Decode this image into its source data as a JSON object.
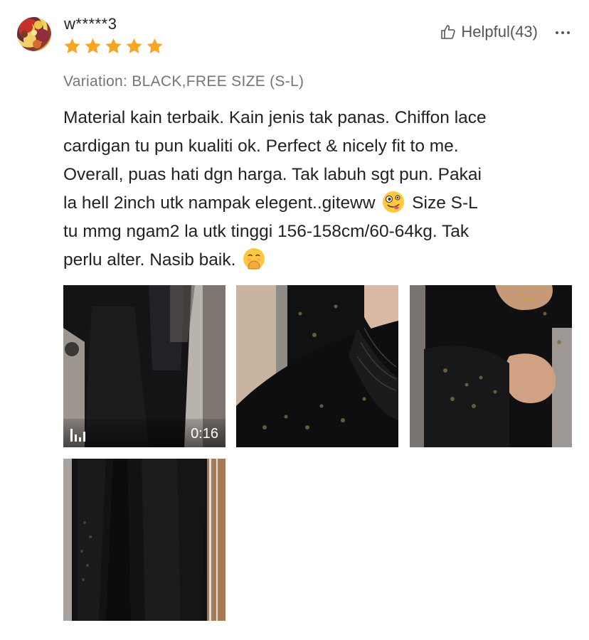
{
  "review": {
    "username": "w*****3",
    "rating": 5,
    "helpful_label": "Helpful(43)",
    "variation": "Variation: BLACK,FREE SIZE (S-L)",
    "text_lines": [
      "Material kain terbaik. Kain jenis tak panas. Chiffon lace",
      "cardigan tu pun kualiti ok. Perfect & nicely fit to me.",
      "Overall, puas hati dgn harga. Tak labuh sgt pun. Pakai",
      "la hell 2inch utk nampak elegent..giteww",
      "Size S-L",
      "tu mmg ngam2 la utk tinggi 156-158cm/60-64kg. Tak",
      "perlu alter. Nasib baik."
    ],
    "emojis": [
      "zany-face-emoji",
      "hand-over-mouth-emoji"
    ],
    "star_color": "#F6A623",
    "media": [
      {
        "type": "video",
        "duration": "0:16"
      },
      {
        "type": "image"
      },
      {
        "type": "image"
      },
      {
        "type": "image"
      }
    ]
  },
  "icons": {
    "helpful": "thumbs-up-icon",
    "more": "more-options-icon",
    "video": "video-icon"
  }
}
